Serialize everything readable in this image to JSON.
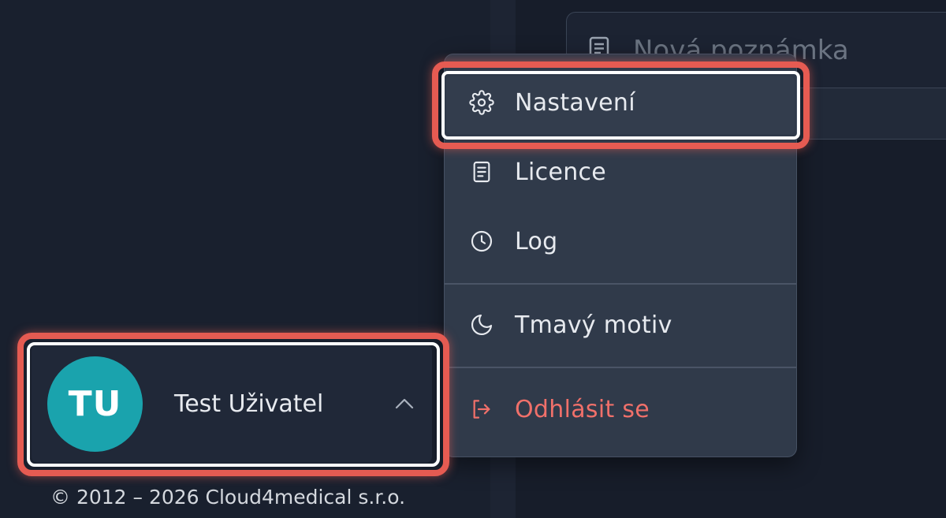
{
  "note": {
    "placeholder": "Nová poznámka",
    "icon": "note-icon"
  },
  "menu": {
    "items": [
      {
        "label": "Nastavení",
        "icon": "gear-icon",
        "highlighted": true
      },
      {
        "label": "Licence",
        "icon": "document-icon"
      },
      {
        "label": "Log",
        "icon": "clock-icon"
      },
      {
        "label": "Tmavý motiv",
        "icon": "moon-icon"
      },
      {
        "label": "Odhlásit se",
        "icon": "logout-icon",
        "color": "#f0706a"
      }
    ]
  },
  "user": {
    "initials": "TU",
    "name": "Test Uživatel",
    "avatar_color": "#1aa3ad",
    "chevron": "chevron-up-icon"
  },
  "footer": {
    "copyright": "© 2012 – 2026 Cloud4medical s.r.o."
  },
  "colors": {
    "highlight": "#e55b52",
    "danger": "#f0706a",
    "background": "#1a2130",
    "menu_bg": "#303a4a"
  }
}
